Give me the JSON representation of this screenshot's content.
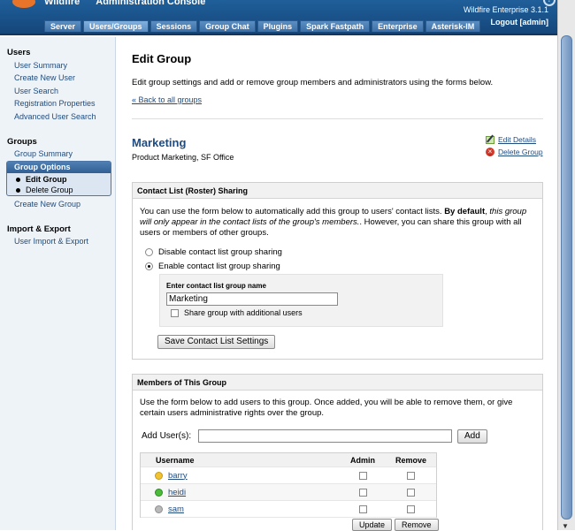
{
  "header": {
    "brand": "Wildfire",
    "console_title": "Administration Console",
    "version": "Wildfire Enterprise 3.1.1",
    "logout": "Logout [admin]",
    "help_glyph": "?",
    "tabs": [
      "Server",
      "Users/Groups",
      "Sessions",
      "Group Chat",
      "Plugins",
      "Spark Fastpath",
      "Enterprise",
      "Asterisk-IM"
    ],
    "active_tab": "Users/Groups"
  },
  "sidebar": {
    "users_heading": "Users",
    "users_items": [
      "User Summary",
      "Create New User",
      "User Search",
      "Registration Properties",
      "Advanced User Search"
    ],
    "groups_heading": "Groups",
    "group_summary": "Group Summary",
    "group_options_heading": "Group Options",
    "group_options_items": [
      "Edit Group",
      "Delete Group"
    ],
    "create_group": "Create New Group",
    "import_heading": "Import & Export",
    "import_items": [
      "User Import & Export"
    ]
  },
  "main": {
    "title": "Edit Group",
    "description": "Edit group settings and add or remove group members and administrators using the forms below.",
    "back_link": "« Back to all groups",
    "group_name": "Marketing",
    "group_description": "Product Marketing, SF Office",
    "edit_details": "Edit Details",
    "delete_group": "Delete Group"
  },
  "roster": {
    "heading": "Contact List (Roster) Sharing",
    "text_1": "You can use the form below to automatically add this group to users' contact lists. ",
    "text_bold": "By default",
    "text_2": ", ",
    "text_italic": "this group will only appear in the contact lists of the group's members.",
    "text_3": ". However, you can share this group with all users or members of other groups.",
    "option_disable": "Disable contact list group sharing",
    "option_enable": "Enable contact list group sharing",
    "name_label": "Enter contact list group name",
    "name_value": "Marketing",
    "share_additional": "Share group with additional users",
    "save_button": "Save Contact List Settings"
  },
  "members": {
    "heading": "Members of This Group",
    "text": "Use the form below to add users to this group. Once added, you will be able to remove them, or give certain users administrative rights over the group.",
    "add_label": "Add User(s):",
    "add_value": "",
    "add_button": "Add",
    "col_username": "Username",
    "col_admin": "Admin",
    "col_remove": "Remove",
    "rows": [
      {
        "username": "barry",
        "status": "away"
      },
      {
        "username": "heidi",
        "status": "online"
      },
      {
        "username": "sam",
        "status": "offline"
      }
    ],
    "update_button": "Update",
    "remove_button": "Remove"
  },
  "colors": {
    "header_blue": "#1f5f9a",
    "link_blue": "#1f4b7f",
    "accent_orange": "#e8742a"
  }
}
